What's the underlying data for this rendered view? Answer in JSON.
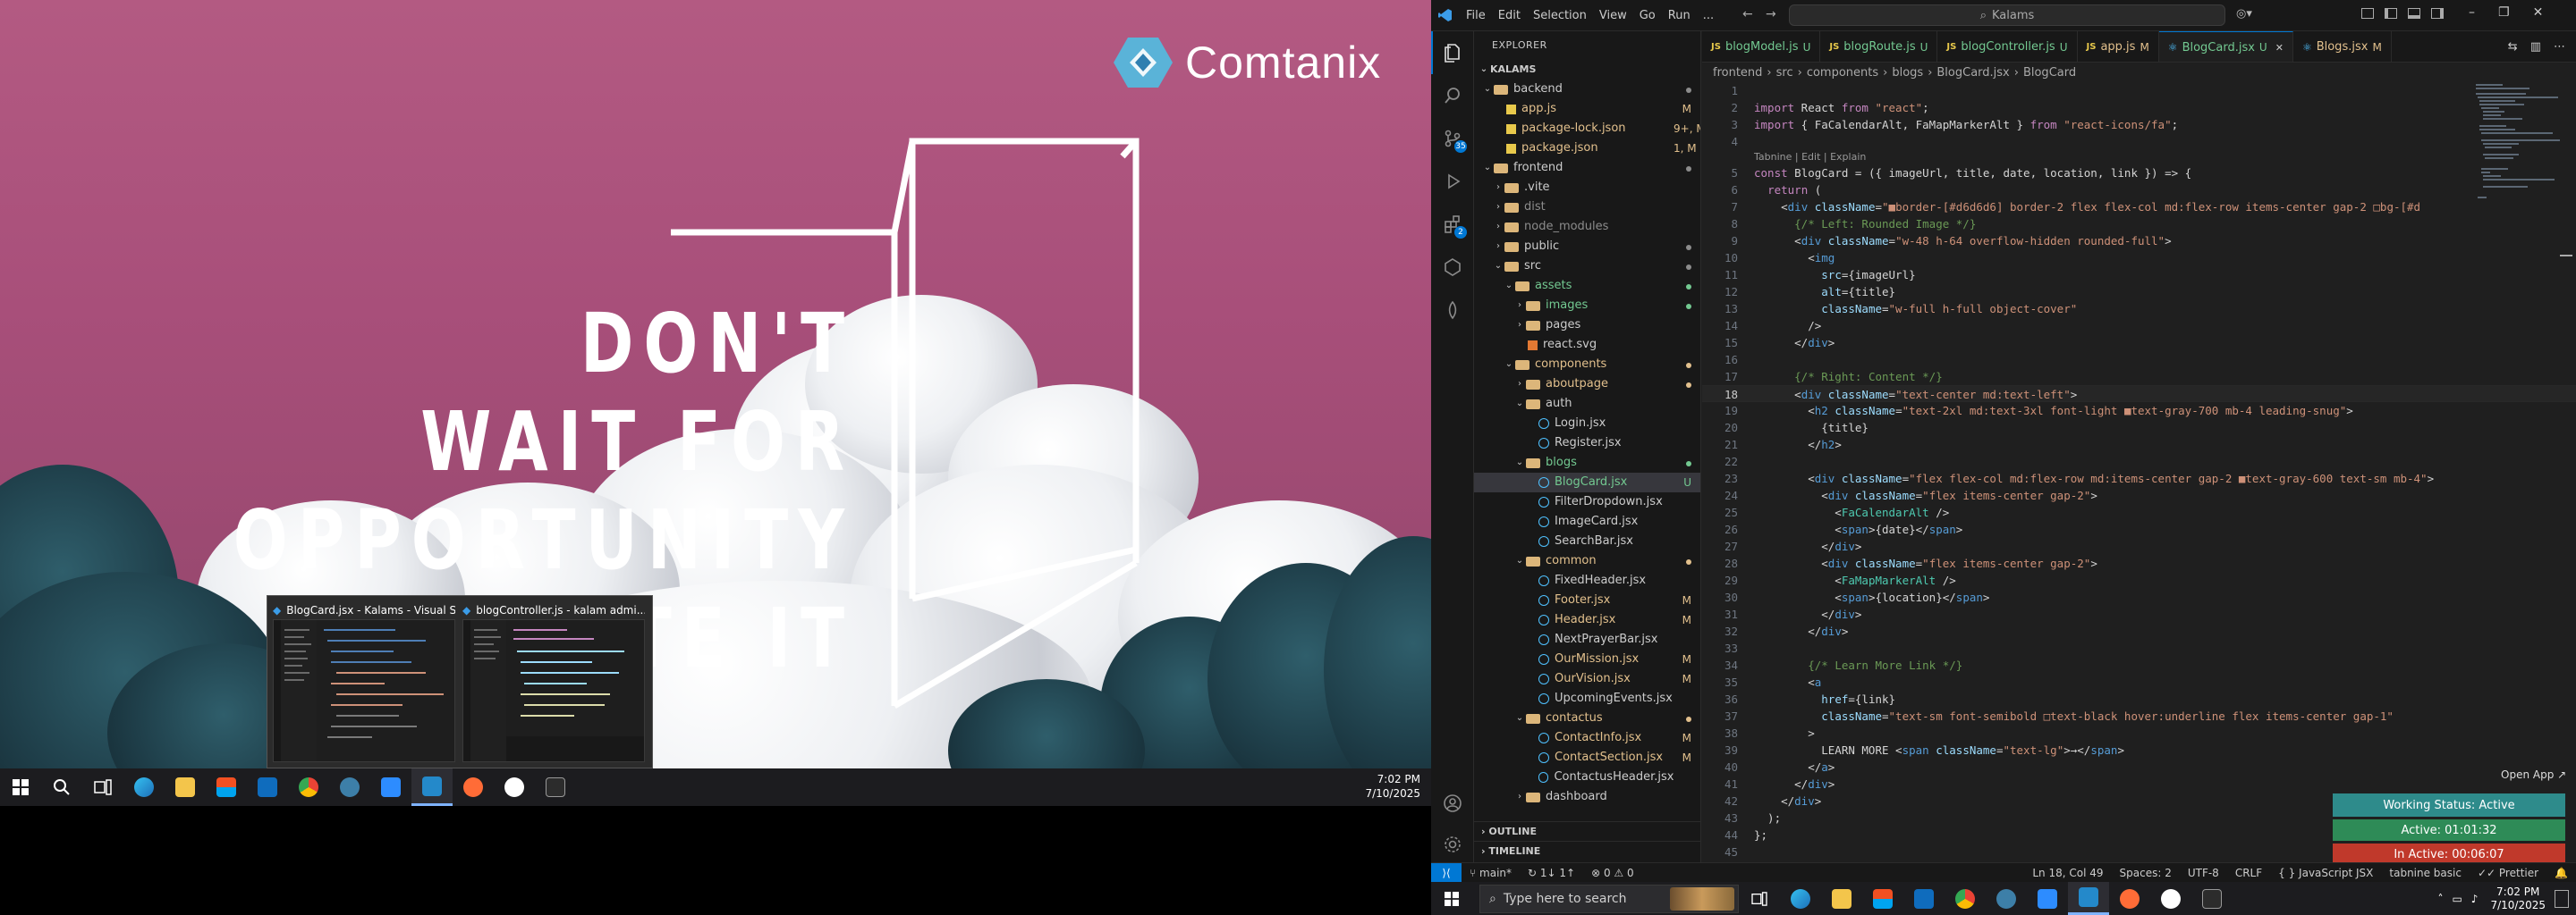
{
  "wallpaper": {
    "brand": "Comtanix",
    "quote_lines": [
      "DON'T",
      "WAIT FOR",
      "OPPORTUNITY",
      "CREATE IT"
    ]
  },
  "thumbnails": [
    {
      "title": "BlogCard.jsx - Kalams - Visual S..."
    },
    {
      "title": "blogController.js - kalam admi..."
    }
  ],
  "taskbar_left": {
    "time": "7:02 PM",
    "date": "7/10/2025",
    "icons": [
      "start-icon",
      "search-icon",
      "task-view-icon",
      "edge-icon",
      "file-explorer-icon",
      "store-icon",
      "outlook-icon",
      "chrome-icon",
      "app-icon",
      "zoom-icon",
      "vscode-icon",
      "postman-icon",
      "vpn-icon",
      "terminal-icon"
    ]
  },
  "vscode": {
    "menu": [
      "File",
      "Edit",
      "Selection",
      "View",
      "Go",
      "Run",
      "..."
    ],
    "command_center": "Kalams",
    "activity_badges": {
      "source_control": "35",
      "extensions": "2"
    },
    "explorer_title": "EXPLORER",
    "root": "KALAMS",
    "tree": [
      {
        "label": "backend",
        "depth": 0,
        "type": "folder",
        "open": true,
        "badge": "dot"
      },
      {
        "label": "app.js",
        "depth": 1,
        "type": "js",
        "badge": "M",
        "color": "#e2c08d"
      },
      {
        "label": "package-lock.json",
        "depth": 1,
        "type": "json",
        "badge": "9+, M",
        "color": "#e2c08d"
      },
      {
        "label": "package.json",
        "depth": 1,
        "type": "json",
        "badge": "1, M",
        "color": "#e2c08d"
      },
      {
        "label": "frontend",
        "depth": 0,
        "type": "folder",
        "open": true,
        "badge": "dot"
      },
      {
        "label": ".vite",
        "depth": 1,
        "type": "folder",
        "open": false,
        "badge": ""
      },
      {
        "label": "dist",
        "depth": 1,
        "type": "folder",
        "open": false,
        "badge": "",
        "color": "#8c8c8c"
      },
      {
        "label": "node_modules",
        "depth": 1,
        "type": "folder",
        "open": false,
        "badge": "",
        "color": "#8c8c8c"
      },
      {
        "label": "public",
        "depth": 1,
        "type": "folder",
        "open": false,
        "badge": "dot"
      },
      {
        "label": "src",
        "depth": 1,
        "type": "folder",
        "open": true,
        "badge": "dot"
      },
      {
        "label": "assets",
        "depth": 2,
        "type": "folder",
        "open": true,
        "badge": "dot",
        "color": "#73c991"
      },
      {
        "label": "images",
        "depth": 3,
        "type": "folder",
        "open": false,
        "badge": "dot",
        "color": "#73c991"
      },
      {
        "label": "pages",
        "depth": 3,
        "type": "folder",
        "open": false,
        "badge": ""
      },
      {
        "label": "react.svg",
        "depth": 3,
        "type": "svg",
        "badge": ""
      },
      {
        "label": "components",
        "depth": 2,
        "type": "folder",
        "open": true,
        "badge": "dot",
        "color": "#e2c08d"
      },
      {
        "label": "aboutpage",
        "depth": 3,
        "type": "folder",
        "open": false,
        "badge": "dot",
        "color": "#e2c08d"
      },
      {
        "label": "auth",
        "depth": 3,
        "type": "folder",
        "open": true,
        "badge": ""
      },
      {
        "label": "Login.jsx",
        "depth": 4,
        "type": "jsx",
        "badge": ""
      },
      {
        "label": "Register.jsx",
        "depth": 4,
        "type": "jsx",
        "badge": ""
      },
      {
        "label": "blogs",
        "depth": 3,
        "type": "folder",
        "open": true,
        "badge": "dot",
        "color": "#73c991"
      },
      {
        "label": "BlogCard.jsx",
        "depth": 4,
        "type": "jsx",
        "badge": "U",
        "color": "#73c991",
        "selected": true
      },
      {
        "label": "FilterDropdown.jsx",
        "depth": 4,
        "type": "jsx",
        "badge": ""
      },
      {
        "label": "ImageCard.jsx",
        "depth": 4,
        "type": "jsx",
        "badge": ""
      },
      {
        "label": "SearchBar.jsx",
        "depth": 4,
        "type": "jsx",
        "badge": ""
      },
      {
        "label": "common",
        "depth": 3,
        "type": "folder",
        "open": true,
        "badge": "dot",
        "color": "#e2c08d"
      },
      {
        "label": "FixedHeader.jsx",
        "depth": 4,
        "type": "jsx",
        "badge": ""
      },
      {
        "label": "Footer.jsx",
        "depth": 4,
        "type": "jsx",
        "badge": "M",
        "color": "#e2c08d"
      },
      {
        "label": "Header.jsx",
        "depth": 4,
        "type": "jsx",
        "badge": "M",
        "color": "#e2c08d"
      },
      {
        "label": "NextPrayerBar.jsx",
        "depth": 4,
        "type": "jsx",
        "badge": ""
      },
      {
        "label": "OurMission.jsx",
        "depth": 4,
        "type": "jsx",
        "badge": "M",
        "color": "#e2c08d"
      },
      {
        "label": "OurVision.jsx",
        "depth": 4,
        "type": "jsx",
        "badge": "M",
        "color": "#e2c08d"
      },
      {
        "label": "UpcomingEvents.jsx",
        "depth": 4,
        "type": "jsx",
        "badge": ""
      },
      {
        "label": "contactus",
        "depth": 3,
        "type": "folder",
        "open": true,
        "badge": "dot",
        "color": "#e2c08d"
      },
      {
        "label": "ContactInfo.jsx",
        "depth": 4,
        "type": "jsx",
        "badge": "M",
        "color": "#e2c08d"
      },
      {
        "label": "ContactSection.jsx",
        "depth": 4,
        "type": "jsx",
        "badge": "M",
        "color": "#e2c08d"
      },
      {
        "label": "ContactusHeader.jsx",
        "depth": 4,
        "type": "jsx",
        "badge": ""
      },
      {
        "label": "dashboard",
        "depth": 3,
        "type": "folder",
        "open": false,
        "badge": ""
      }
    ],
    "outline": "OUTLINE",
    "timeline": "TIMELINE",
    "tabs": [
      {
        "label": "blogModel.js",
        "type": "js",
        "badge": "U"
      },
      {
        "label": "blogRoute.js",
        "type": "js",
        "badge": "U"
      },
      {
        "label": "blogController.js",
        "type": "js",
        "badge": "U"
      },
      {
        "label": "app.js",
        "type": "js",
        "badge": "M"
      },
      {
        "label": "BlogCard.jsx",
        "type": "jsx",
        "badge": "U",
        "active": true
      },
      {
        "label": "Blogs.jsx",
        "type": "jsx",
        "badge": "M"
      }
    ],
    "breadcrumb": [
      "frontend",
      "src",
      "components",
      "blogs",
      "BlogCard.jsx",
      "BlogCard"
    ],
    "code_lens": "Tabnine | Edit | Explain",
    "current_line": 18,
    "code": [
      "",
      "import React from \"react\";",
      "import { FaCalendarAlt, FaMapMarkerAlt } from \"react-icons/fa\";",
      "",
      "const BlogCard = ({ imageUrl, title, date, location, link }) => {",
      "  return (",
      "    <div className=\"■border-[#d6d6d6] border-2 flex flex-col md:flex-row items-center gap-2 □bg-[#d",
      "      {/* Left: Rounded Image */}",
      "      <div className=\"w-48 h-64 overflow-hidden rounded-full\">",
      "        <img",
      "          src={imageUrl}",
      "          alt={title}",
      "          className=\"w-full h-full object-cover\"",
      "        />",
      "      </div>",
      "",
      "      {/* Right: Content */}",
      "      <div className=\"text-center md:text-left\">",
      "        <h2 className=\"text-2xl md:text-3xl font-light ■text-gray-700 mb-4 leading-snug\">",
      "          {title}",
      "        </h2>",
      "",
      "        <div className=\"flex flex-col md:flex-row md:items-center gap-2 ■text-gray-600 text-sm mb-4\">",
      "          <div className=\"flex items-center gap-2\">",
      "            <FaCalendarAlt />",
      "            <span>{date}</span>",
      "          </div>",
      "          <div className=\"flex items-center gap-2\">",
      "            <FaMapMarkerAlt />",
      "            <span>{location}</span>",
      "          </div>",
      "        </div>",
      "",
      "        {/* Learn More Link */}",
      "        <a",
      "          href={link}",
      "          className=\"text-sm font-semibold □text-black hover:underline flex items-center gap-1\"",
      "        >",
      "          LEARN MORE <span className=\"text-lg\">→</span>",
      "        </a>",
      "      </div>",
      "    </div>",
      "  );",
      "};",
      ""
    ],
    "status": {
      "branch": "main*",
      "sync": "↻ 1↓ 1↑",
      "problems": "⊗ 0 ⚠ 0",
      "cursor": "Ln 18, Col 49",
      "spaces": "Spaces: 2",
      "encoding": "UTF-8",
      "eol": "CRLF",
      "language": "JavaScript JSX",
      "tabnine": "tabnine basic",
      "prettier": "Prettier"
    },
    "open_app": "Open App ↗",
    "working_status": "Working Status: Active",
    "active_time": "Active: 01:01:32",
    "inactive_time": "In Active: 00:06:07"
  },
  "taskbar_right": {
    "search_placeholder": "Type here to search",
    "time": "7:02 PM",
    "date": "7/10/2025"
  },
  "colors": {
    "accent": "#0078d4",
    "modified": "#e2c08d",
    "untracked": "#73c991",
    "working_green": "#2e8b57",
    "inactive_red": "#c0392b"
  }
}
